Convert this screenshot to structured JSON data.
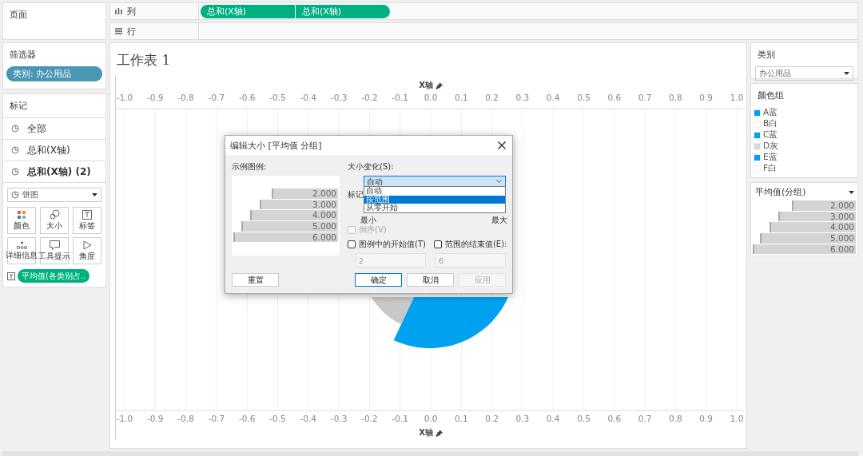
{
  "pages_shelf": {
    "title": "页面"
  },
  "columns_shelf": {
    "label": "列",
    "pills": [
      "总和(X轴)",
      "总和(X轴)"
    ]
  },
  "rows_shelf": {
    "label": "行"
  },
  "filters": {
    "title": "筛选器",
    "pills": [
      "类别: 办公用品"
    ]
  },
  "marks": {
    "title": "标记",
    "layers": [
      {
        "label": "全部",
        "selected": false
      },
      {
        "label": "总和(X轴)",
        "selected": false
      },
      {
        "label": "总和(X轴) (2)",
        "selected": true
      }
    ],
    "mark_type": "饼图",
    "buttons": [
      {
        "label": "颜色",
        "kind": "color"
      },
      {
        "label": "大小",
        "kind": "size"
      },
      {
        "label": "标签",
        "kind": "label"
      },
      {
        "label": "详细信息",
        "kind": "detail"
      },
      {
        "label": "工具提示",
        "kind": "tooltip"
      },
      {
        "label": "角度",
        "kind": "angle"
      }
    ],
    "field_pill": "平均值(各类别占.."
  },
  "sheet": {
    "title": "工作表 1",
    "top_axis_title": "X轴",
    "bottom_axis_title": "X轴",
    "top_ticks": [
      "-1.0",
      "-0.9",
      "-0.8",
      "-0.7",
      "-0.6",
      "-0.5",
      "-0.4",
      "-0.3",
      "-0.2",
      "-0.1",
      "0.0",
      "0.1",
      "0.2",
      "0.3",
      "0.4",
      "0.5",
      "0.6",
      "0.7",
      "0.8",
      "0.9",
      "1.0"
    ],
    "bottom_ticks": [
      "-1.0",
      "-0.9",
      "-0.8",
      "-0.7",
      "-0.6",
      "-0.5",
      "-0.4",
      "-0.3",
      "-0.2",
      "-0.1",
      "0.0",
      "0.1",
      "0.2",
      "0.3",
      "0.4",
      "0.5",
      "0.6",
      "0.7",
      "0.8",
      "0.9",
      "1.0"
    ]
  },
  "dialog": {
    "title": "编辑大小 [平均值 分组]",
    "sample_label": "示例图例:",
    "sample_items": [
      {
        "label": "2.000",
        "level": 0.63
      },
      {
        "label": "3.000",
        "level": 0.75
      },
      {
        "label": "4.000",
        "level": 0.84
      },
      {
        "label": "5.000",
        "level": 0.92
      },
      {
        "label": "6.000",
        "level": 1
      }
    ],
    "size_label": "大小变化(S):",
    "dropdown_value": "自动",
    "options": [
      {
        "label": "自动",
        "selected": false
      },
      {
        "label": "按范围",
        "selected": true
      },
      {
        "label": "从零开始",
        "selected": false
      }
    ],
    "partial_label": "标记",
    "min_label": "最小",
    "max_label": "最大",
    "checkboxes": [
      {
        "label": "倒序(V)",
        "checked": false,
        "disabled": true
      },
      {
        "label": "图例中的开始值(T)",
        "checked": false,
        "disabled": false
      },
      {
        "label": "范围的结束值(E):",
        "checked": false,
        "disabled": false
      }
    ],
    "fields": [
      "2",
      "6"
    ],
    "buttons": [
      {
        "label": "重置",
        "default": false,
        "disabled": false
      },
      {
        "label": "确定",
        "default": true,
        "disabled": false
      },
      {
        "label": "取消",
        "default": false,
        "disabled": false
      },
      {
        "label": "应用",
        "default": false,
        "disabled": true
      }
    ]
  },
  "category_filter": {
    "title": "类别",
    "value": "办公用品"
  },
  "color_legend": {
    "title": "颜色组",
    "items": [
      {
        "label": "A蓝",
        "color": "#00a2f0"
      },
      {
        "label": "B白",
        "color": "#ffffff"
      },
      {
        "label": "C蓝",
        "color": "#00a2f0"
      },
      {
        "label": "D灰",
        "color": "#d9d9d9"
      },
      {
        "label": "E蓝",
        "color": "#00a2f0"
      },
      {
        "label": "F白",
        "color": "#ffffff"
      }
    ]
  },
  "size_legend": {
    "title": "平均值(分组)",
    "items": [
      {
        "label": "2.000",
        "level": 0.62
      },
      {
        "label": "3.000",
        "level": 0.75
      },
      {
        "label": "4.000",
        "level": 0.84
      },
      {
        "label": "5.000",
        "level": 0.93
      },
      {
        "label": "6.000",
        "level": 1
      }
    ]
  }
}
